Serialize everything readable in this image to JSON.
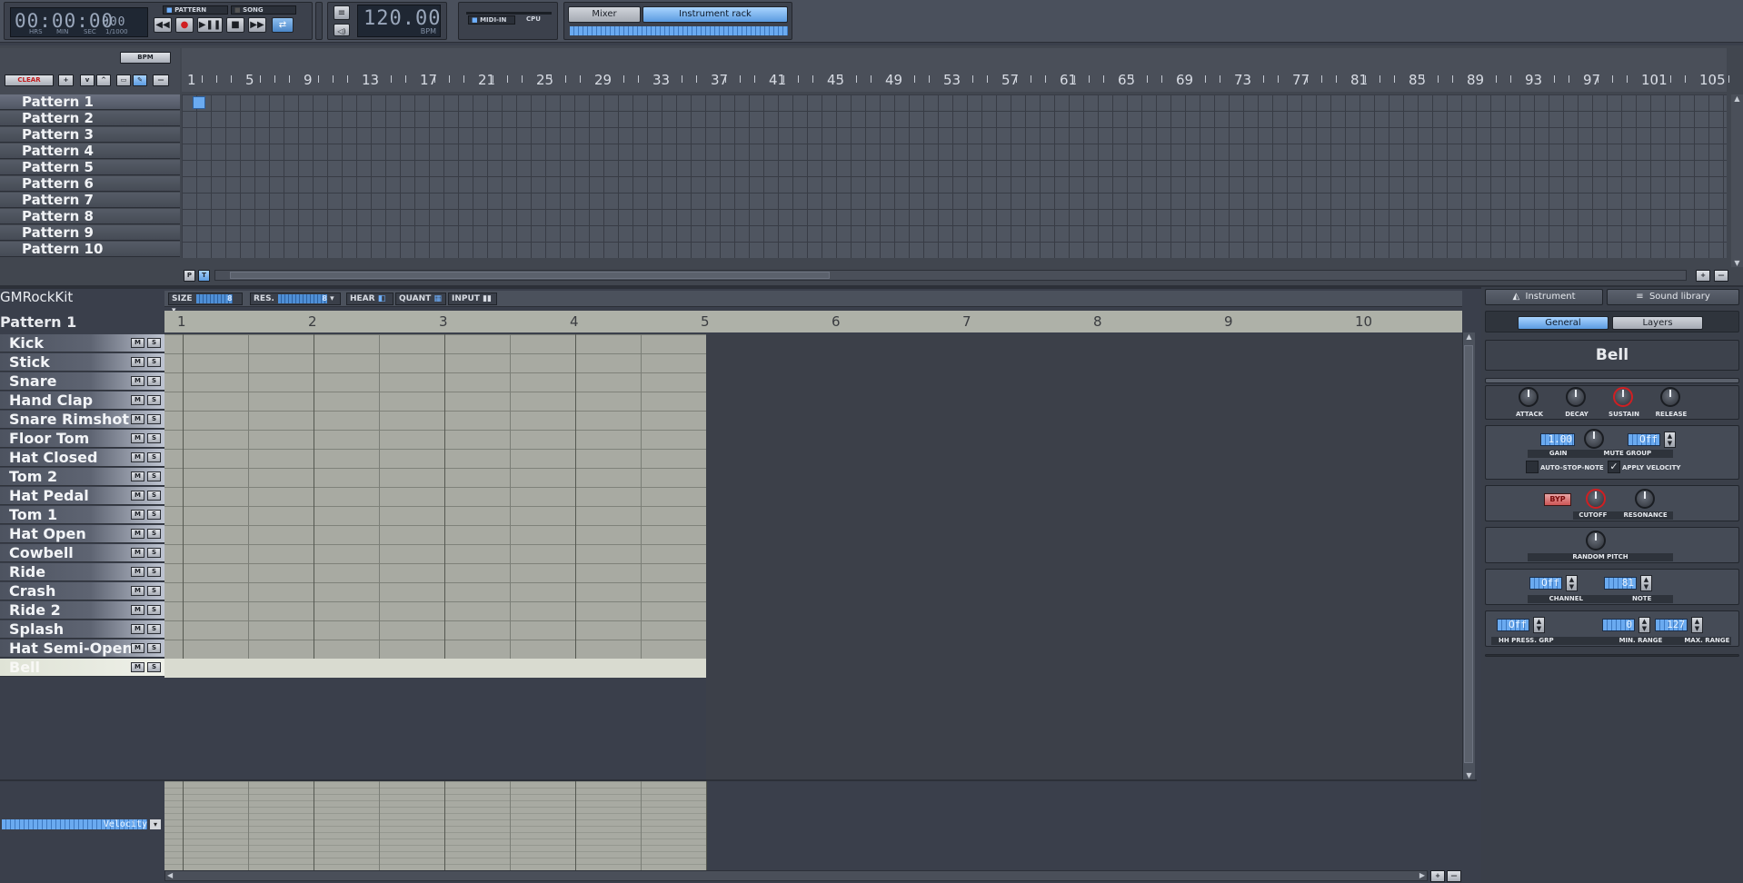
{
  "toolbar": {
    "time": "00:00:00",
    "time_ms": "000",
    "time_units": [
      "HRS",
      "MIN",
      "SEC",
      "1/1000"
    ],
    "mode_pattern": "PATTERN",
    "mode_song": "SONG",
    "bpm_value": "120.00",
    "bpm_label": "BPM",
    "midi_in": "MIDI-IN",
    "cpu": "CPU",
    "mixer": "Mixer",
    "instrument_rack": "Instrument rack"
  },
  "song": {
    "bpm_button": "BPM",
    "clear": "CLEAR",
    "ruler": [
      "1",
      "5",
      "9",
      "13",
      "17",
      "21",
      "25",
      "29",
      "33",
      "37",
      "41",
      "45",
      "49",
      "53",
      "57",
      "61",
      "65",
      "69",
      "73",
      "77",
      "81",
      "85",
      "89",
      "93",
      "97",
      "101",
      "105"
    ],
    "patterns": [
      "Pattern 1",
      "Pattern 2",
      "Pattern 3",
      "Pattern 4",
      "Pattern 5",
      "Pattern 6",
      "Pattern 7",
      "Pattern 8",
      "Pattern 9",
      "Pattern 10"
    ],
    "p_button": "P",
    "t_button": "T"
  },
  "pattern_editor": {
    "drumkit": "GMRockKit",
    "pattern_name": "Pattern 1",
    "size_label": "SIZE",
    "size_value": "8",
    "res_label": "RES.",
    "res_value": "8",
    "hear": "HEAR",
    "quant": "QUANT",
    "input": "INPUT",
    "ruler": [
      "1",
      "2",
      "3",
      "4",
      "5",
      "6",
      "7",
      "8",
      "9",
      "10"
    ],
    "instruments": [
      "Kick",
      "Stick",
      "Snare",
      "Hand Clap",
      "Snare Rimshot",
      "Floor Tom",
      "Hat Closed",
      "Tom 2",
      "Hat Pedal",
      "Tom 1",
      "Hat Open",
      "Cowbell",
      "Ride",
      "Crash",
      "Ride 2",
      "Splash",
      "Hat Semi-Open",
      "Bell"
    ],
    "mute": "M",
    "solo": "S",
    "velocity": "Velocity"
  },
  "instrument_panel": {
    "tab_instrument": "Instrument",
    "tab_library": "Sound library",
    "tab_general": "General",
    "tab_layers": "Layers",
    "name": "Bell",
    "adsr": [
      "ATTACK",
      "DECAY",
      "SUSTAIN",
      "RELEASE"
    ],
    "gain_value": "1.00",
    "gain": "GAIN",
    "mute_group_value": "Off",
    "mute_group": "MUTE GROUP",
    "auto_stop": "AUTO-STOP-NOTE",
    "apply_velocity": "APPLY VELOCITY",
    "byp": "BYP",
    "cutoff": "CUTOFF",
    "resonance": "RESONANCE",
    "random_pitch": "RANDOM PITCH",
    "channel_value": "Off",
    "channel": "CHANNEL",
    "note_value": "81",
    "note": "NOTE",
    "hh_value": "Off",
    "hh_press": "HH PRESS. GRP",
    "min_value": "0",
    "min_range": "MIN. RANGE",
    "max_value": "127",
    "max_range": "MAX. RANGE"
  }
}
